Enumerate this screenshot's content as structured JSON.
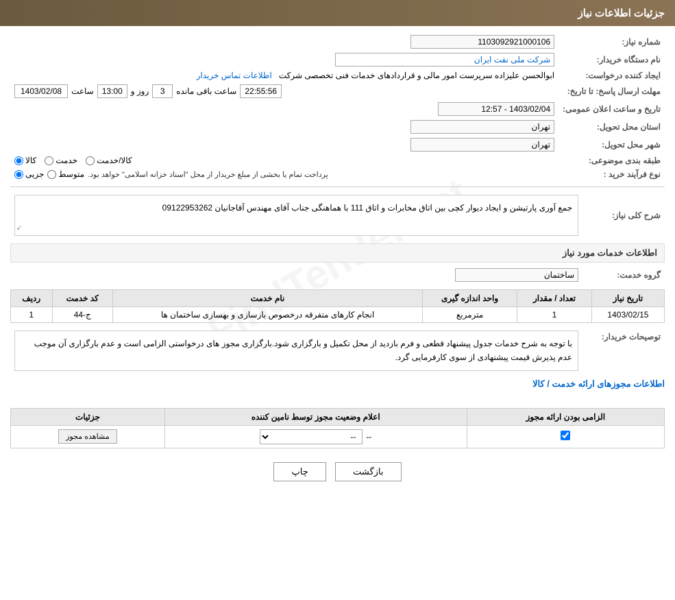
{
  "header": {
    "title": "جزئیات اطلاعات نیاز"
  },
  "fields": {
    "request_number_label": "شماره نیاز:",
    "request_number_value": "1103092921000106",
    "buyer_label": "نام دستگاه خریدار:",
    "buyer_value": "شرکت ملی نفت ایران",
    "creator_label": "ایجاد کننده درخواست:",
    "creator_value": "ابوالحسن علیزاده سرپرست امور مالی و قراردادهای خدمات فنی تخصصی شرکت",
    "contact_link": "اطلاعات تماس خریدار",
    "date_label": "تاریخ و ساعت اعلان عمومی:",
    "date_value": "1403/02/04 - 12:57",
    "response_deadline_label": "مهلت ارسال پاسخ: تا تاریخ:",
    "response_date": "1403/02/08",
    "response_time": "13:00",
    "response_days": "3",
    "response_remaining": "22:55:56",
    "response_days_label": "روز و",
    "response_hours_label": "ساعت باقی مانده",
    "response_time_label": "ساعت",
    "province_label": "استان محل تحویل:",
    "province_value": "تهران",
    "city_label": "شهر محل تحویل:",
    "city_value": "تهران",
    "category_label": "طبقه بندی موضوعی:",
    "category_kala": "کالا",
    "category_khedmat": "خدمت",
    "category_kala_khedmat": "کالا/خدمت",
    "process_label": "نوع فرآیند خرید :",
    "process_jazee": "جزیی",
    "process_motevaset": "متوسط",
    "process_note": "پرداخت تمام یا بخشی از مبلغ خریدار از محل \"اسناد خزانه اسلامی\" خواهد بود.",
    "description_label": "شرح کلی نیاز:",
    "description_value": "جمع آوری پارتیشن و ایجاد دیوار کچی بین اتاق مخابرات و اتاق 111 با هماهنگی جناب  آقای مهندس آقاجانیان  09122953262",
    "services_info_label": "اطلاعات خدمات مورد نیاز",
    "service_group_label": "گروه خدمت:",
    "service_group_value": "ساختمان",
    "table_headers": {
      "row_num": "ردیف",
      "service_code": "کد خدمت",
      "service_name": "نام خدمت",
      "unit": "واحد اندازه گیری",
      "quantity": "تعداد / مقدار",
      "date": "تاریخ نیاز"
    },
    "table_rows": [
      {
        "row": "1",
        "code": "ج-44",
        "name": "انجام کارهای متفرقه درخصوص بازسازی و بهسازی ساختمان ها",
        "unit": "مترمربع",
        "quantity": "1",
        "date": "1403/02/15"
      }
    ],
    "buyer_notes_label": "توصیحات خریدار:",
    "buyer_notes_value": "با توجه به شرح خدمات جدول پیشنهاد قطعی و فرم بازدید از محل تکمیل و بارگزاری شود.بارگزاری مجوز های درخواستی الزامی است و عدم بارگزاری آن موجب عدم پذیرش قیمت پیشنهادی  از سوی کارفرمایی گرد.",
    "permit_section_label": "اطلاعات مجوزهای ارائه خدمت / کالا",
    "permit_table_headers": {
      "required": "الزامی بودن ارائه مجوز",
      "status": "اعلام وضعیت مجوز توسط نامین کننده",
      "details": "جزئیات"
    },
    "permit_row": {
      "required_checked": true,
      "status_value": "--",
      "details_btn": "مشاهده مجوز"
    }
  },
  "footer": {
    "print_btn": "چاپ",
    "back_btn": "بازگشت"
  }
}
